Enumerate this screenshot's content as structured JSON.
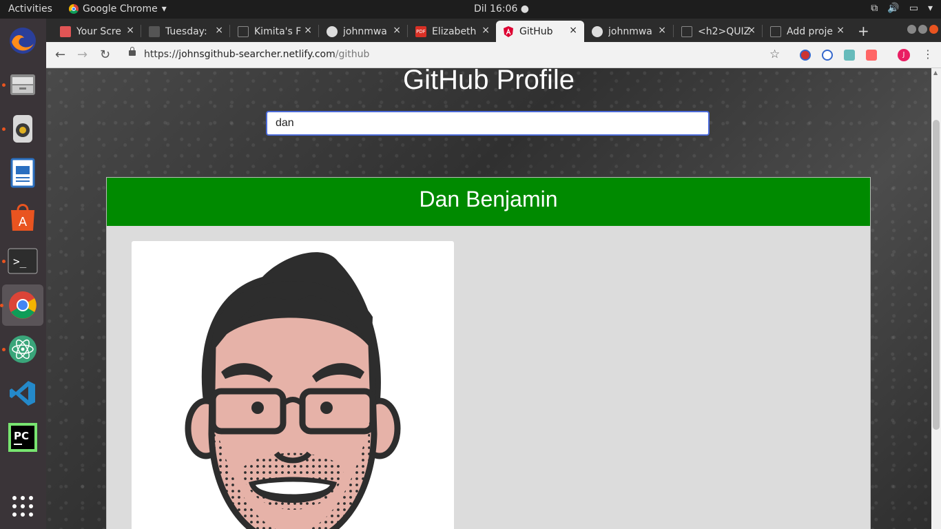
{
  "system_bar": {
    "activities": "Activities",
    "app_name": "Google Chrome",
    "clock": "Dil 16:06 ●"
  },
  "dock": {
    "items": [
      "firefox-icon",
      "files-icon",
      "rhythmbox-icon",
      "libreoffice-writer-icon",
      "software-center-icon",
      "terminal-icon",
      "chrome-icon",
      "atom-icon",
      "vscode-icon",
      "pycharm-icon",
      "app-grid-icon"
    ]
  },
  "browser": {
    "tabs": [
      {
        "label": "Your Scre",
        "close": "×",
        "icon_color": "#e05555"
      },
      {
        "label": "Tuesday:",
        "close": "×",
        "icon_color": "#666666"
      },
      {
        "label": "Kimita's F",
        "close": "×",
        "icon_color": "#888888"
      },
      {
        "label": "johnmwa",
        "close": "×",
        "icon_color": "#dddddd"
      },
      {
        "label": "Elizabeth",
        "close": "×",
        "icon_color": "#d93025"
      },
      {
        "label": "GitHub",
        "close": "×",
        "icon_color": "#dd0031"
      },
      {
        "label": "johnmwa",
        "close": "×",
        "icon_color": "#dddddd"
      },
      {
        "label": "<h2>QUIZ",
        "close": "×",
        "icon_color": "#888888"
      },
      {
        "label": "Add proje",
        "close": "×",
        "icon_color": "#888888"
      }
    ],
    "new_tab": "+",
    "url": {
      "scheme": "https://",
      "host": "johnsgithub-searcher.netlify.com",
      "path": "/github"
    }
  },
  "page": {
    "title": "GitHub Profile",
    "search_value": "dan",
    "profile_name": "Dan Benjamin",
    "header_color": "#008a00"
  }
}
